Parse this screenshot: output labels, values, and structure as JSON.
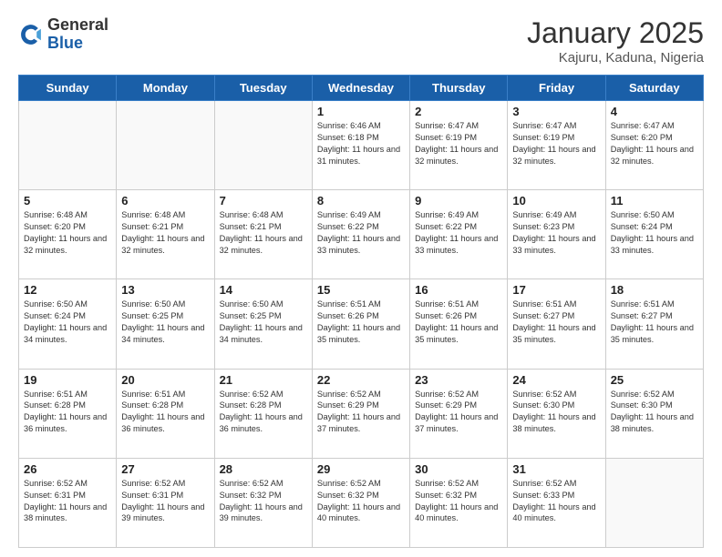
{
  "header": {
    "logo_general": "General",
    "logo_blue": "Blue",
    "month_title": "January 2025",
    "location": "Kajuru, Kaduna, Nigeria"
  },
  "days_of_week": [
    "Sunday",
    "Monday",
    "Tuesday",
    "Wednesday",
    "Thursday",
    "Friday",
    "Saturday"
  ],
  "weeks": [
    [
      {
        "day": "",
        "sunrise": "",
        "sunset": "",
        "daylight": ""
      },
      {
        "day": "",
        "sunrise": "",
        "sunset": "",
        "daylight": ""
      },
      {
        "day": "",
        "sunrise": "",
        "sunset": "",
        "daylight": ""
      },
      {
        "day": "1",
        "sunrise": "Sunrise: 6:46 AM",
        "sunset": "Sunset: 6:18 PM",
        "daylight": "Daylight: 11 hours and 31 minutes."
      },
      {
        "day": "2",
        "sunrise": "Sunrise: 6:47 AM",
        "sunset": "Sunset: 6:19 PM",
        "daylight": "Daylight: 11 hours and 32 minutes."
      },
      {
        "day": "3",
        "sunrise": "Sunrise: 6:47 AM",
        "sunset": "Sunset: 6:19 PM",
        "daylight": "Daylight: 11 hours and 32 minutes."
      },
      {
        "day": "4",
        "sunrise": "Sunrise: 6:47 AM",
        "sunset": "Sunset: 6:20 PM",
        "daylight": "Daylight: 11 hours and 32 minutes."
      }
    ],
    [
      {
        "day": "5",
        "sunrise": "Sunrise: 6:48 AM",
        "sunset": "Sunset: 6:20 PM",
        "daylight": "Daylight: 11 hours and 32 minutes."
      },
      {
        "day": "6",
        "sunrise": "Sunrise: 6:48 AM",
        "sunset": "Sunset: 6:21 PM",
        "daylight": "Daylight: 11 hours and 32 minutes."
      },
      {
        "day": "7",
        "sunrise": "Sunrise: 6:48 AM",
        "sunset": "Sunset: 6:21 PM",
        "daylight": "Daylight: 11 hours and 32 minutes."
      },
      {
        "day": "8",
        "sunrise": "Sunrise: 6:49 AM",
        "sunset": "Sunset: 6:22 PM",
        "daylight": "Daylight: 11 hours and 33 minutes."
      },
      {
        "day": "9",
        "sunrise": "Sunrise: 6:49 AM",
        "sunset": "Sunset: 6:22 PM",
        "daylight": "Daylight: 11 hours and 33 minutes."
      },
      {
        "day": "10",
        "sunrise": "Sunrise: 6:49 AM",
        "sunset": "Sunset: 6:23 PM",
        "daylight": "Daylight: 11 hours and 33 minutes."
      },
      {
        "day": "11",
        "sunrise": "Sunrise: 6:50 AM",
        "sunset": "Sunset: 6:24 PM",
        "daylight": "Daylight: 11 hours and 33 minutes."
      }
    ],
    [
      {
        "day": "12",
        "sunrise": "Sunrise: 6:50 AM",
        "sunset": "Sunset: 6:24 PM",
        "daylight": "Daylight: 11 hours and 34 minutes."
      },
      {
        "day": "13",
        "sunrise": "Sunrise: 6:50 AM",
        "sunset": "Sunset: 6:25 PM",
        "daylight": "Daylight: 11 hours and 34 minutes."
      },
      {
        "day": "14",
        "sunrise": "Sunrise: 6:50 AM",
        "sunset": "Sunset: 6:25 PM",
        "daylight": "Daylight: 11 hours and 34 minutes."
      },
      {
        "day": "15",
        "sunrise": "Sunrise: 6:51 AM",
        "sunset": "Sunset: 6:26 PM",
        "daylight": "Daylight: 11 hours and 35 minutes."
      },
      {
        "day": "16",
        "sunrise": "Sunrise: 6:51 AM",
        "sunset": "Sunset: 6:26 PM",
        "daylight": "Daylight: 11 hours and 35 minutes."
      },
      {
        "day": "17",
        "sunrise": "Sunrise: 6:51 AM",
        "sunset": "Sunset: 6:27 PM",
        "daylight": "Daylight: 11 hours and 35 minutes."
      },
      {
        "day": "18",
        "sunrise": "Sunrise: 6:51 AM",
        "sunset": "Sunset: 6:27 PM",
        "daylight": "Daylight: 11 hours and 35 minutes."
      }
    ],
    [
      {
        "day": "19",
        "sunrise": "Sunrise: 6:51 AM",
        "sunset": "Sunset: 6:28 PM",
        "daylight": "Daylight: 11 hours and 36 minutes."
      },
      {
        "day": "20",
        "sunrise": "Sunrise: 6:51 AM",
        "sunset": "Sunset: 6:28 PM",
        "daylight": "Daylight: 11 hours and 36 minutes."
      },
      {
        "day": "21",
        "sunrise": "Sunrise: 6:52 AM",
        "sunset": "Sunset: 6:28 PM",
        "daylight": "Daylight: 11 hours and 36 minutes."
      },
      {
        "day": "22",
        "sunrise": "Sunrise: 6:52 AM",
        "sunset": "Sunset: 6:29 PM",
        "daylight": "Daylight: 11 hours and 37 minutes."
      },
      {
        "day": "23",
        "sunrise": "Sunrise: 6:52 AM",
        "sunset": "Sunset: 6:29 PM",
        "daylight": "Daylight: 11 hours and 37 minutes."
      },
      {
        "day": "24",
        "sunrise": "Sunrise: 6:52 AM",
        "sunset": "Sunset: 6:30 PM",
        "daylight": "Daylight: 11 hours and 38 minutes."
      },
      {
        "day": "25",
        "sunrise": "Sunrise: 6:52 AM",
        "sunset": "Sunset: 6:30 PM",
        "daylight": "Daylight: 11 hours and 38 minutes."
      }
    ],
    [
      {
        "day": "26",
        "sunrise": "Sunrise: 6:52 AM",
        "sunset": "Sunset: 6:31 PM",
        "daylight": "Daylight: 11 hours and 38 minutes."
      },
      {
        "day": "27",
        "sunrise": "Sunrise: 6:52 AM",
        "sunset": "Sunset: 6:31 PM",
        "daylight": "Daylight: 11 hours and 39 minutes."
      },
      {
        "day": "28",
        "sunrise": "Sunrise: 6:52 AM",
        "sunset": "Sunset: 6:32 PM",
        "daylight": "Daylight: 11 hours and 39 minutes."
      },
      {
        "day": "29",
        "sunrise": "Sunrise: 6:52 AM",
        "sunset": "Sunset: 6:32 PM",
        "daylight": "Daylight: 11 hours and 40 minutes."
      },
      {
        "day": "30",
        "sunrise": "Sunrise: 6:52 AM",
        "sunset": "Sunset: 6:32 PM",
        "daylight": "Daylight: 11 hours and 40 minutes."
      },
      {
        "day": "31",
        "sunrise": "Sunrise: 6:52 AM",
        "sunset": "Sunset: 6:33 PM",
        "daylight": "Daylight: 11 hours and 40 minutes."
      },
      {
        "day": "",
        "sunrise": "",
        "sunset": "",
        "daylight": ""
      }
    ]
  ]
}
